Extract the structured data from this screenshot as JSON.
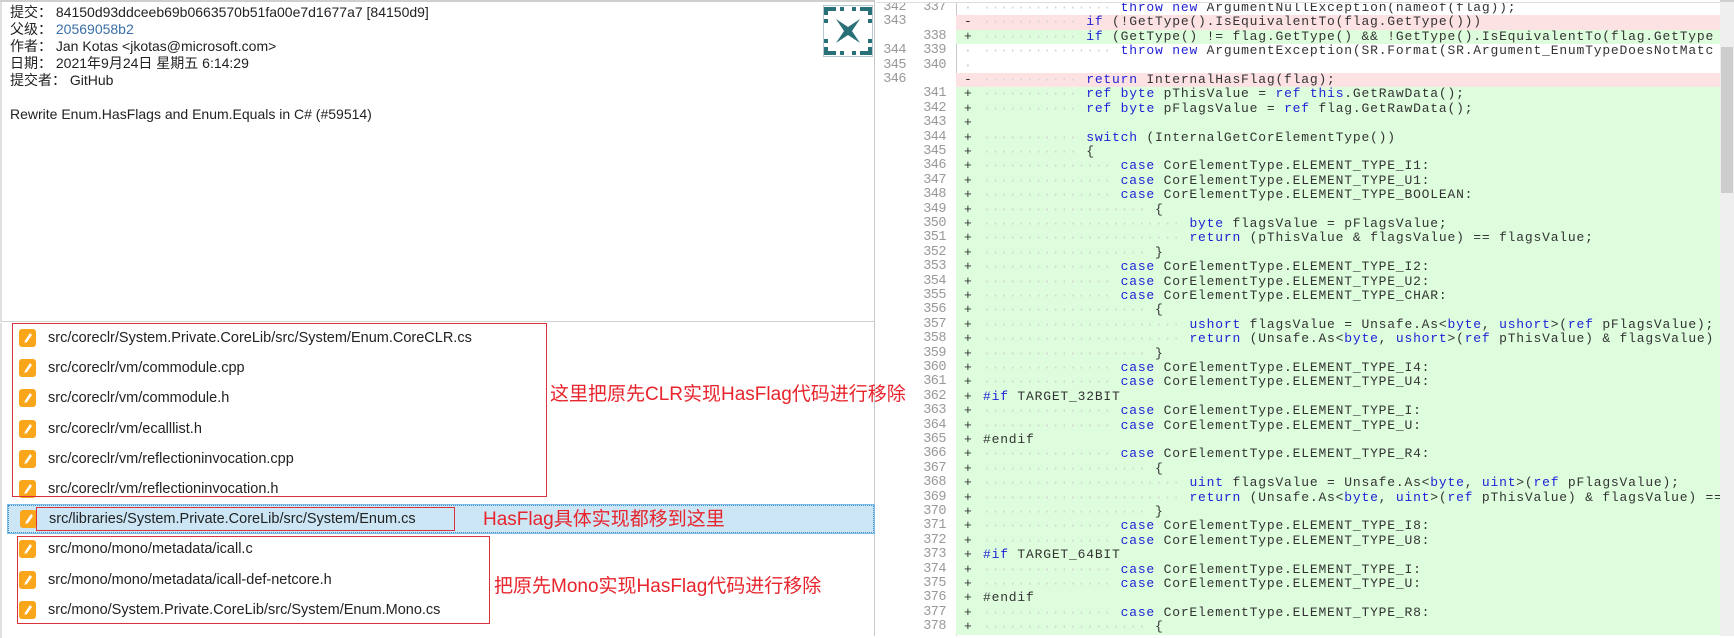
{
  "commit": {
    "sha_label": "提交：",
    "sha": "84150d93ddceeb69b0663570b51fa00e7d1677a7 [84150d9]",
    "parent_label": "父级：",
    "parent": "20569058b2",
    "author_label": "作者：",
    "author": "Jan Kotas <jkotas@microsoft.com>",
    "date_label": "日期：",
    "date": "2021年9月24日 星期五 6:14:29",
    "committer_label": "提交者：",
    "committer": "GitHub",
    "message": "Rewrite Enum.HasFlags and Enum.Equals in C# (#59514)"
  },
  "files": [
    {
      "path": "src/coreclr/System.Private.CoreLib/src/System/Enum.CoreCLR.cs",
      "icon": "modified-file-icon"
    },
    {
      "path": "src/coreclr/vm/commodule.cpp",
      "icon": "modified-file-icon"
    },
    {
      "path": "src/coreclr/vm/commodule.h",
      "icon": "modified-file-icon"
    },
    {
      "path": "src/coreclr/vm/ecalllist.h",
      "icon": "modified-file-icon"
    },
    {
      "path": "src/coreclr/vm/reflectioninvocation.cpp",
      "icon": "modified-file-icon"
    },
    {
      "path": "src/coreclr/vm/reflectioninvocation.h",
      "icon": "modified-file-icon"
    },
    {
      "path": "src/libraries/System.Private.CoreLib/src/System/Enum.cs",
      "icon": "modified-file-icon",
      "selected": true
    },
    {
      "path": "src/mono/mono/metadata/icall.c",
      "icon": "modified-file-icon"
    },
    {
      "path": "src/mono/mono/metadata/icall-def-netcore.h",
      "icon": "modified-file-icon"
    },
    {
      "path": "src/mono/System.Private.CoreLib/src/System/Enum.Mono.cs",
      "icon": "modified-file-icon"
    }
  ],
  "annotations": {
    "clr": "这里把原先CLR实现HasFlag代码进行移除",
    "moved": "HasFlag具体实现都移到这里",
    "mono": "把原先Mono实现HasFlag代码进行移除"
  },
  "colors": {
    "added_bg": "#ddfddd",
    "removed_bg": "#fde2e4",
    "keyword": "#2222d6",
    "annotation": "#e8242c",
    "file_icon": "#f9a61a",
    "avatar": "#2a7079"
  },
  "diff": [
    {
      "old": "342",
      "new": "337",
      "type": "ctx",
      "code": "                throw new ArgumentNullException(nameof(flag));"
    },
    {
      "old": "343",
      "new": "",
      "type": "del",
      "code": "            if (!GetType().IsEquivalentTo(flag.GetType()))"
    },
    {
      "old": "",
      "new": "338",
      "type": "add",
      "code": "            if (GetType() != flag.GetType() && !GetType().IsEquivalentTo(flag.GetType"
    },
    {
      "old": "344",
      "new": "339",
      "type": "ctx",
      "code": "                throw new ArgumentException(SR.Format(SR.Argument_EnumTypeDoesNotMatc"
    },
    {
      "old": "345",
      "new": "340",
      "type": "ctx",
      "code": ""
    },
    {
      "old": "346",
      "new": "",
      "type": "del",
      "code": "            return InternalHasFlag(flag);"
    },
    {
      "old": "",
      "new": "341",
      "type": "add",
      "code": "            ref byte pThisValue = ref this.GetRawData();"
    },
    {
      "old": "",
      "new": "342",
      "type": "add",
      "code": "            ref byte pFlagsValue = ref flag.GetRawData();"
    },
    {
      "old": "",
      "new": "343",
      "type": "add",
      "code": ""
    },
    {
      "old": "",
      "new": "344",
      "type": "add",
      "code": "            switch (InternalGetCorElementType())"
    },
    {
      "old": "",
      "new": "345",
      "type": "add",
      "code": "            {"
    },
    {
      "old": "",
      "new": "346",
      "type": "add",
      "code": "                case CorElementType.ELEMENT_TYPE_I1:"
    },
    {
      "old": "",
      "new": "347",
      "type": "add",
      "code": "                case CorElementType.ELEMENT_TYPE_U1:"
    },
    {
      "old": "",
      "new": "348",
      "type": "add",
      "code": "                case CorElementType.ELEMENT_TYPE_BOOLEAN:"
    },
    {
      "old": "",
      "new": "349",
      "type": "add",
      "code": "                    {"
    },
    {
      "old": "",
      "new": "350",
      "type": "add",
      "code": "                        byte flagsValue = pFlagsValue;"
    },
    {
      "old": "",
      "new": "351",
      "type": "add",
      "code": "                        return (pThisValue & flagsValue) == flagsValue;"
    },
    {
      "old": "",
      "new": "352",
      "type": "add",
      "code": "                    }"
    },
    {
      "old": "",
      "new": "353",
      "type": "add",
      "code": "                case CorElementType.ELEMENT_TYPE_I2:"
    },
    {
      "old": "",
      "new": "354",
      "type": "add",
      "code": "                case CorElementType.ELEMENT_TYPE_U2:"
    },
    {
      "old": "",
      "new": "355",
      "type": "add",
      "code": "                case CorElementType.ELEMENT_TYPE_CHAR:"
    },
    {
      "old": "",
      "new": "356",
      "type": "add",
      "code": "                    {"
    },
    {
      "old": "",
      "new": "357",
      "type": "add",
      "code": "                        ushort flagsValue = Unsafe.As<byte, ushort>(ref pFlagsValue);"
    },
    {
      "old": "",
      "new": "358",
      "type": "add",
      "code": "                        return (Unsafe.As<byte, ushort>(ref pThisValue) & flagsValue)"
    },
    {
      "old": "",
      "new": "359",
      "type": "add",
      "code": "                    }"
    },
    {
      "old": "",
      "new": "360",
      "type": "add",
      "code": "                case CorElementType.ELEMENT_TYPE_I4:"
    },
    {
      "old": "",
      "new": "361",
      "type": "add",
      "code": "                case CorElementType.ELEMENT_TYPE_U4:"
    },
    {
      "old": "",
      "new": "362",
      "type": "add",
      "code": "#if TARGET_32BIT"
    },
    {
      "old": "",
      "new": "363",
      "type": "add",
      "code": "                case CorElementType.ELEMENT_TYPE_I:"
    },
    {
      "old": "",
      "new": "364",
      "type": "add",
      "code": "                case CorElementType.ELEMENT_TYPE_U:"
    },
    {
      "old": "",
      "new": "365",
      "type": "add",
      "code": "#endif"
    },
    {
      "old": "",
      "new": "366",
      "type": "add",
      "code": "                case CorElementType.ELEMENT_TYPE_R4:"
    },
    {
      "old": "",
      "new": "367",
      "type": "add",
      "code": "                    {"
    },
    {
      "old": "",
      "new": "368",
      "type": "add",
      "code": "                        uint flagsValue = Unsafe.As<byte, uint>(ref pFlagsValue);"
    },
    {
      "old": "",
      "new": "369",
      "type": "add",
      "code": "                        return (Unsafe.As<byte, uint>(ref pThisValue) & flagsValue) =="
    },
    {
      "old": "",
      "new": "370",
      "type": "add",
      "code": "                    }"
    },
    {
      "old": "",
      "new": "371",
      "type": "add",
      "code": "                case CorElementType.ELEMENT_TYPE_I8:"
    },
    {
      "old": "",
      "new": "372",
      "type": "add",
      "code": "                case CorElementType.ELEMENT_TYPE_U8:"
    },
    {
      "old": "",
      "new": "373",
      "type": "add",
      "code": "#if TARGET_64BIT"
    },
    {
      "old": "",
      "new": "374",
      "type": "add",
      "code": "                case CorElementType.ELEMENT_TYPE_I:"
    },
    {
      "old": "",
      "new": "375",
      "type": "add",
      "code": "                case CorElementType.ELEMENT_TYPE_U:"
    },
    {
      "old": "",
      "new": "376",
      "type": "add",
      "code": "#endif"
    },
    {
      "old": "",
      "new": "377",
      "type": "add",
      "code": "                case CorElementType.ELEMENT_TYPE_R8:"
    },
    {
      "old": "",
      "new": "378",
      "type": "add",
      "code": "                    {"
    }
  ]
}
